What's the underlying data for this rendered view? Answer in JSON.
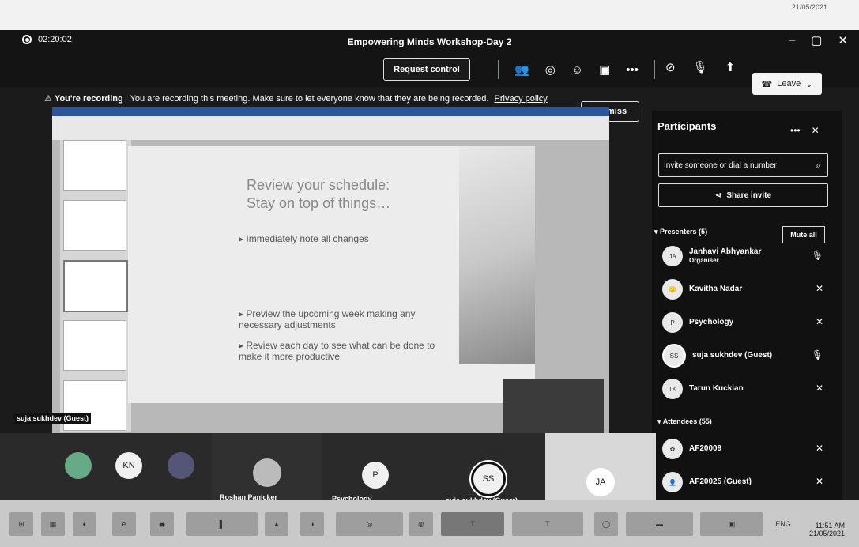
{
  "screen": {
    "date_stamp": "21/05/2021"
  },
  "titlebar": {
    "title": "Empowering Minds Workshop-Day 2",
    "timer": "02:20:02"
  },
  "toolbar": {
    "request_control": "Request control",
    "leave": "Leave"
  },
  "banner": {
    "label": "You're recording",
    "message": "You are recording this meeting. Make sure to let everyone know that they are being recorded.",
    "link": "Privacy policy",
    "dismiss": "Dismiss"
  },
  "slide": {
    "title": "Review your schedule:\nStay on top of things…",
    "bullets": [
      "Immediately note all changes",
      "Preview the upcoming week making any necessary adjustments",
      "Review each day to see what can be done to make it more productive"
    ]
  },
  "presenter_label": "suja sukhdev (Guest)",
  "participants": {
    "title": "Participants",
    "invite_placeholder": "Invite someone or dial a number",
    "share_invite": "Share invite",
    "presenters_label": "Presenters (5)",
    "mute_all": "Mute all",
    "presenters": [
      {
        "initials": "JA",
        "name": "Janhavi Abhyankar",
        "role": "Organiser"
      },
      {
        "initials": "",
        "name": "Kavitha Nadar",
        "role": ""
      },
      {
        "initials": "P",
        "name": "Psychology",
        "role": ""
      },
      {
        "initials": "SS",
        "name": "suja sukhdev (Guest)",
        "role": ""
      },
      {
        "initials": "TK",
        "name": "Tarun Kuckian",
        "role": ""
      }
    ],
    "attendees_label": "Attendees (55)",
    "attendees": [
      {
        "initials": "",
        "name": "AF20009"
      },
      {
        "initials": "",
        "name": "AF20025 (Guest)"
      }
    ]
  },
  "gallery": {
    "tiles": [
      {
        "initials": "KN",
        "label": ""
      },
      {
        "initials": "",
        "label": "Roshan Panicker"
      },
      {
        "initials": "P",
        "label": "Psychology"
      },
      {
        "initials": "SS",
        "label": "suja sukhdev (Guest)"
      },
      {
        "initials": "JA",
        "label": ""
      }
    ]
  },
  "taskbar": {
    "time": "11:51 AM",
    "date": "21/05/2021",
    "lang": "ENG"
  }
}
